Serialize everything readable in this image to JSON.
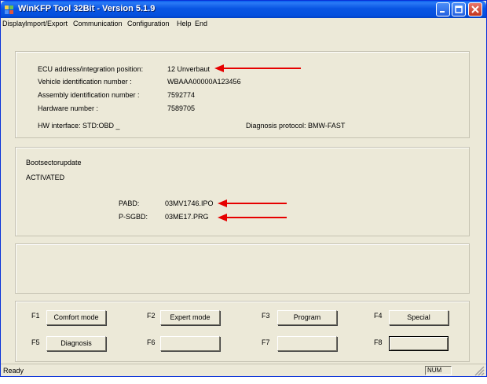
{
  "window": {
    "title": "WinKFP Tool 32Bit - Version 5.1.9",
    "title_color": "#0a5fef"
  },
  "menu": [
    "Display",
    "Import/Export",
    "Communication",
    "Configuration",
    "Help",
    "End"
  ],
  "ecu_panel": {
    "address_label": "ECU address/integration position:",
    "address_value": "12   Unverbaut",
    "vin_label": "Vehicle identification number :",
    "vin_value": "WBAAA00000A123456",
    "assembly_label": "Assembly identification number :",
    "assembly_value": "7592774",
    "hardware_label": "Hardware number :",
    "hardware_value": "7589705",
    "hw_interface": "HW interface:  STD:OBD _",
    "protocol": "Diagnosis protocol:  BMW-FAST"
  },
  "boot_panel": {
    "title": "Bootsectorupdate",
    "status": "ACTIVATED",
    "pabd_label": "PABD:",
    "pabd_value": "03MV1746.IPO",
    "psgbd_label": "P-SGBD:",
    "psgbd_value": "03ME17.PRG"
  },
  "function_keys": [
    {
      "key": "F1",
      "label": "Comfort mode"
    },
    {
      "key": "F2",
      "label": "Expert mode"
    },
    {
      "key": "F3",
      "label": "Program"
    },
    {
      "key": "F4",
      "label": "Special"
    },
    {
      "key": "F5",
      "label": "Diagnosis"
    },
    {
      "key": "F6",
      "label": ""
    },
    {
      "key": "F7",
      "label": ""
    },
    {
      "key": "F8",
      "label": ""
    }
  ],
  "status": {
    "text": "Ready",
    "pane": "NUM"
  },
  "colors": {
    "arrow": "#e60000"
  }
}
